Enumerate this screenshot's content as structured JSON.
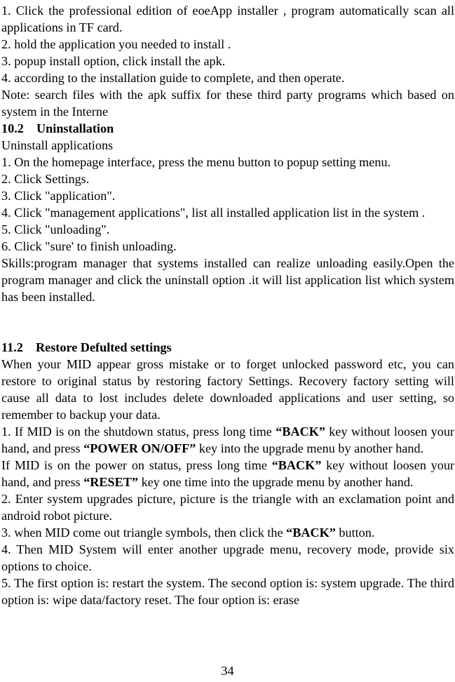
{
  "document": {
    "page_number": "34",
    "blocks": [
      {
        "id": "b1",
        "type": "paragraph",
        "text": "1. Click the professional edition of eoeApp installer , program automatically scan all applications in TF card."
      },
      {
        "id": "b2",
        "type": "paragraph",
        "text": "2. hold the application you needed to install ."
      },
      {
        "id": "b3",
        "type": "paragraph",
        "text": "3. popup install option, click install the apk."
      },
      {
        "id": "b4",
        "type": "paragraph",
        "text": "4. according to the installation guide to complete, and then operate."
      },
      {
        "id": "b5",
        "type": "paragraph",
        "text": "Note: search files with the apk suffix for these third party programs which based on system in the Interne"
      },
      {
        "id": "b6",
        "type": "heading",
        "number": "10.2",
        "title": "Uninstallation",
        "text": "10.2    Uninstallation"
      },
      {
        "id": "b7",
        "type": "paragraph",
        "text": "Uninstall applications"
      },
      {
        "id": "b8",
        "type": "paragraph",
        "text": "1. On the homepage interface, press the menu button to popup setting menu."
      },
      {
        "id": "b9",
        "type": "paragraph",
        "text": "2. Click Settings."
      },
      {
        "id": "b10",
        "type": "paragraph",
        "text": "3. Click \"application\"."
      },
      {
        "id": "b11",
        "type": "paragraph",
        "text": "4. Click \"management applications\", list all installed application list in the system ."
      },
      {
        "id": "b12",
        "type": "paragraph",
        "text": "5. Click \"unloading\"."
      },
      {
        "id": "b13",
        "type": "paragraph",
        "text": "6. Click \"sure' to finish unloading."
      },
      {
        "id": "b14",
        "type": "paragraph",
        "text": "Skills:program manager that systems installed can realize unloading easily.Open the program manager and click the uninstall option .it will list application list which system has been installed."
      },
      {
        "id": "b15",
        "type": "heading",
        "number": "11.2",
        "title": "Restore Defulted settings",
        "text": "11.2    Restore Defulted settings"
      },
      {
        "id": "b16",
        "type": "paragraph",
        "text": "When your MID appear gross mistake or to forget unlocked password etc, you can restore to original status by restoring factory Settings. Recovery factory setting will cause all data to lost includes delete downloaded applications and user setting, so remember to backup your data."
      },
      {
        "id": "b17",
        "type": "rich-paragraph",
        "runs": [
          {
            "text": "1.   If MID is on the shutdown status, press long time ",
            "bold": false
          },
          {
            "text": "“BACK”",
            "bold": true
          },
          {
            "text": "  key without loosen your hand, and press ",
            "bold": false
          },
          {
            "text": "“POWER ON/OFF”",
            "bold": true
          },
          {
            "text": " key into the upgrade menu by another hand.",
            "bold": false
          }
        ]
      },
      {
        "id": "b18",
        "type": "rich-paragraph",
        "runs": [
          {
            "text": "If MID is on the power on status, press long time ",
            "bold": false
          },
          {
            "text": "“BACK”",
            "bold": true
          },
          {
            "text": "  key without loosen your hand, and press ",
            "bold": false
          },
          {
            "text": "“RESET”",
            "bold": true
          },
          {
            "text": " key one time into the upgrade menu by another hand.",
            "bold": false
          }
        ]
      },
      {
        "id": "b19",
        "type": "paragraph",
        "text": "2. Enter system upgrades picture, picture is the triangle with an exclamation point and android robot picture."
      },
      {
        "id": "b20",
        "type": "rich-paragraph",
        "runs": [
          {
            "text": "3. when MID come out   triangle symbols, then click the ",
            "bold": false
          },
          {
            "text": "“BACK”",
            "bold": true
          },
          {
            "text": "   button.",
            "bold": false
          }
        ]
      },
      {
        "id": "b21",
        "type": "paragraph",
        "text": "4. Then MID System will enter another upgrade menu, recovery mode, provide six options to choice."
      },
      {
        "id": "b22",
        "type": "paragraph",
        "text": "5. The first option is: restart the system. The second option is: system upgrade. The third option is: wipe data/factory reset. The four option is: erase"
      }
    ]
  }
}
